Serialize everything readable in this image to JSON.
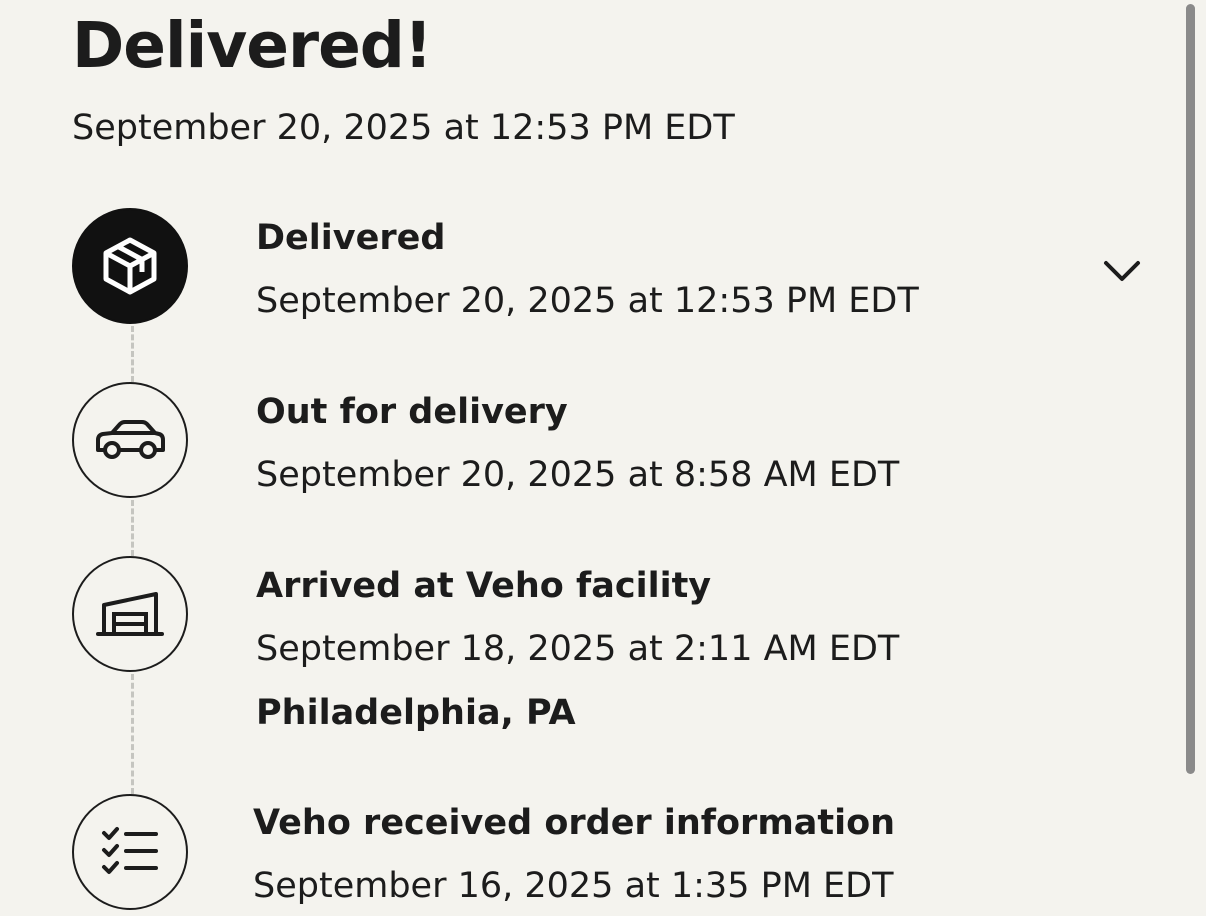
{
  "header": {
    "title": "Delivered!",
    "subtitle": "September 20, 2025 at 12:53 PM EDT"
  },
  "events": [
    {
      "title": "Delivered",
      "date": "September 20, 2025 at 12:53 PM EDT",
      "icon": "package-icon"
    },
    {
      "title": "Out for delivery",
      "date": "September 20, 2025 at 8:58 AM EDT",
      "icon": "car-icon"
    },
    {
      "title": "Arrived at Veho facility",
      "date": "September 18, 2025 at 2:11 AM EDT",
      "location": "Philadelphia, PA",
      "icon": "warehouse-icon"
    },
    {
      "title": "Veho received order information",
      "date": "September 16, 2025 at 1:35 PM EDT",
      "icon": "checklist-icon"
    }
  ],
  "controls": {
    "expand_icon": "chevron-down-icon"
  },
  "colors": {
    "background": "#f4f3ee",
    "text": "#1c1c1c",
    "active_icon_bg": "#111111",
    "timeline": "#c5c5c0"
  }
}
